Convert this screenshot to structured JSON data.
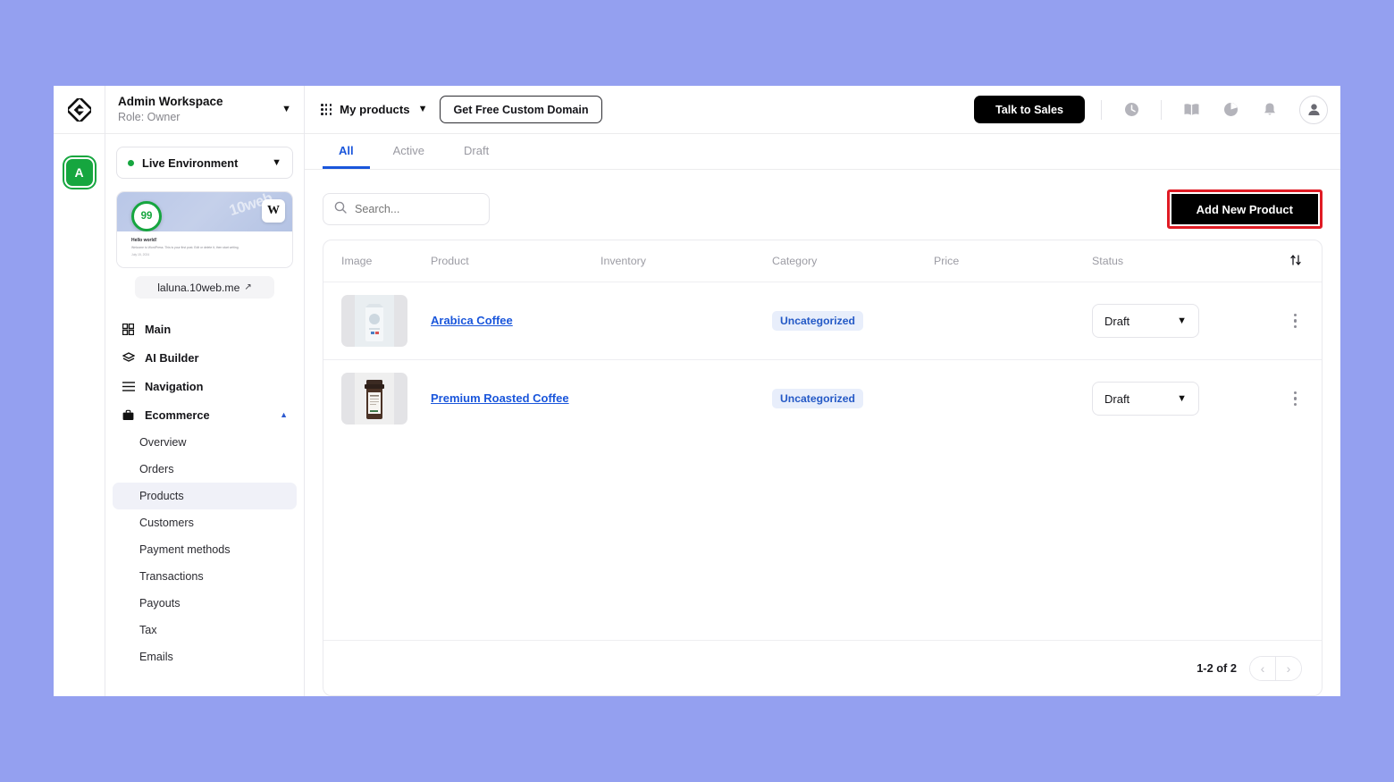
{
  "rail": {
    "logo_icon": "tenweb-diamond-logo",
    "avatar_letter": "A"
  },
  "sidebar": {
    "workspace_name": "Admin Workspace",
    "workspace_role": "Role: Owner",
    "workspace_chevron_icon": "chevron-down-icon",
    "environment": {
      "label": "Live Environment",
      "status_color": "#16a63f",
      "chevron_icon": "chevron-down-icon"
    },
    "site_card": {
      "score": "99",
      "wp_badge": "W",
      "watermark": "10web",
      "preview_title": "Hello world!",
      "preview_text": "Welcome to WordPress. This is your first post. Edit or delete it, then start writing.",
      "preview_date": "July 15, 2024",
      "domain": "laluna.10web.me",
      "external_icon": "external-link-icon"
    },
    "nav": [
      {
        "label": "Main",
        "icon": "grid-icon"
      },
      {
        "label": "AI Builder",
        "icon": "layers-icon"
      },
      {
        "label": "Navigation",
        "icon": "menu-lines-icon"
      },
      {
        "label": "Ecommerce",
        "icon": "briefcase-icon",
        "expanded": true,
        "caret_icon": "chevron-up-icon"
      }
    ],
    "subnav": [
      {
        "label": "Overview",
        "active": false
      },
      {
        "label": "Orders",
        "active": false
      },
      {
        "label": "Products",
        "active": true
      },
      {
        "label": "Customers",
        "active": false
      },
      {
        "label": "Payment methods",
        "active": false
      },
      {
        "label": "Transactions",
        "active": false
      },
      {
        "label": "Payouts",
        "active": false
      },
      {
        "label": "Tax",
        "active": false
      },
      {
        "label": "Emails",
        "active": false
      }
    ]
  },
  "topbar": {
    "grid_icon": "apps-grid-icon",
    "product_switcher_label": "My products",
    "product_switcher_chevron": "chevron-down-icon",
    "custom_domain_button": "Get Free Custom Domain",
    "talk_to_sales_button": "Talk to Sales",
    "icons": [
      {
        "name": "clock-icon"
      },
      {
        "name": "book-icon"
      },
      {
        "name": "pie-chart-icon"
      },
      {
        "name": "bell-icon"
      }
    ],
    "avatar_icon": "user-avatar-icon"
  },
  "tabs": [
    {
      "label": "All",
      "active": true
    },
    {
      "label": "Active",
      "active": false
    },
    {
      "label": "Draft",
      "active": false
    }
  ],
  "toolbar": {
    "search_placeholder": "Search...",
    "search_value": "",
    "search_icon": "search-icon",
    "add_product_label": "Add New Product",
    "highlight_color": "#e01b24"
  },
  "table": {
    "columns": [
      "Image",
      "Product",
      "Inventory",
      "Category",
      "Price",
      "Status"
    ],
    "sort_icon": "sort-arrows-icon",
    "rows": [
      {
        "image_alt": "arabica-coffee-pouch",
        "product": "Arabica Coffee",
        "inventory": "",
        "category": "Uncategorized",
        "price": "",
        "status": "Draft",
        "status_chevron": "chevron-down-icon",
        "menu_icon": "kebab-menu-icon"
      },
      {
        "image_alt": "premium-roasted-coffee-jar",
        "product": "Premium Roasted Coffee",
        "inventory": "",
        "category": "Uncategorized",
        "price": "",
        "status": "Draft",
        "status_chevron": "chevron-down-icon",
        "menu_icon": "kebab-menu-icon"
      }
    ],
    "footer": {
      "count_label": "1-2 of 2",
      "prev_icon": "chevron-left-icon",
      "next_icon": "chevron-right-icon"
    }
  },
  "theme": {
    "accent_blue": "#1a56db",
    "badge_bg": "#e8eefb",
    "page_bg": "#94a0f0"
  }
}
